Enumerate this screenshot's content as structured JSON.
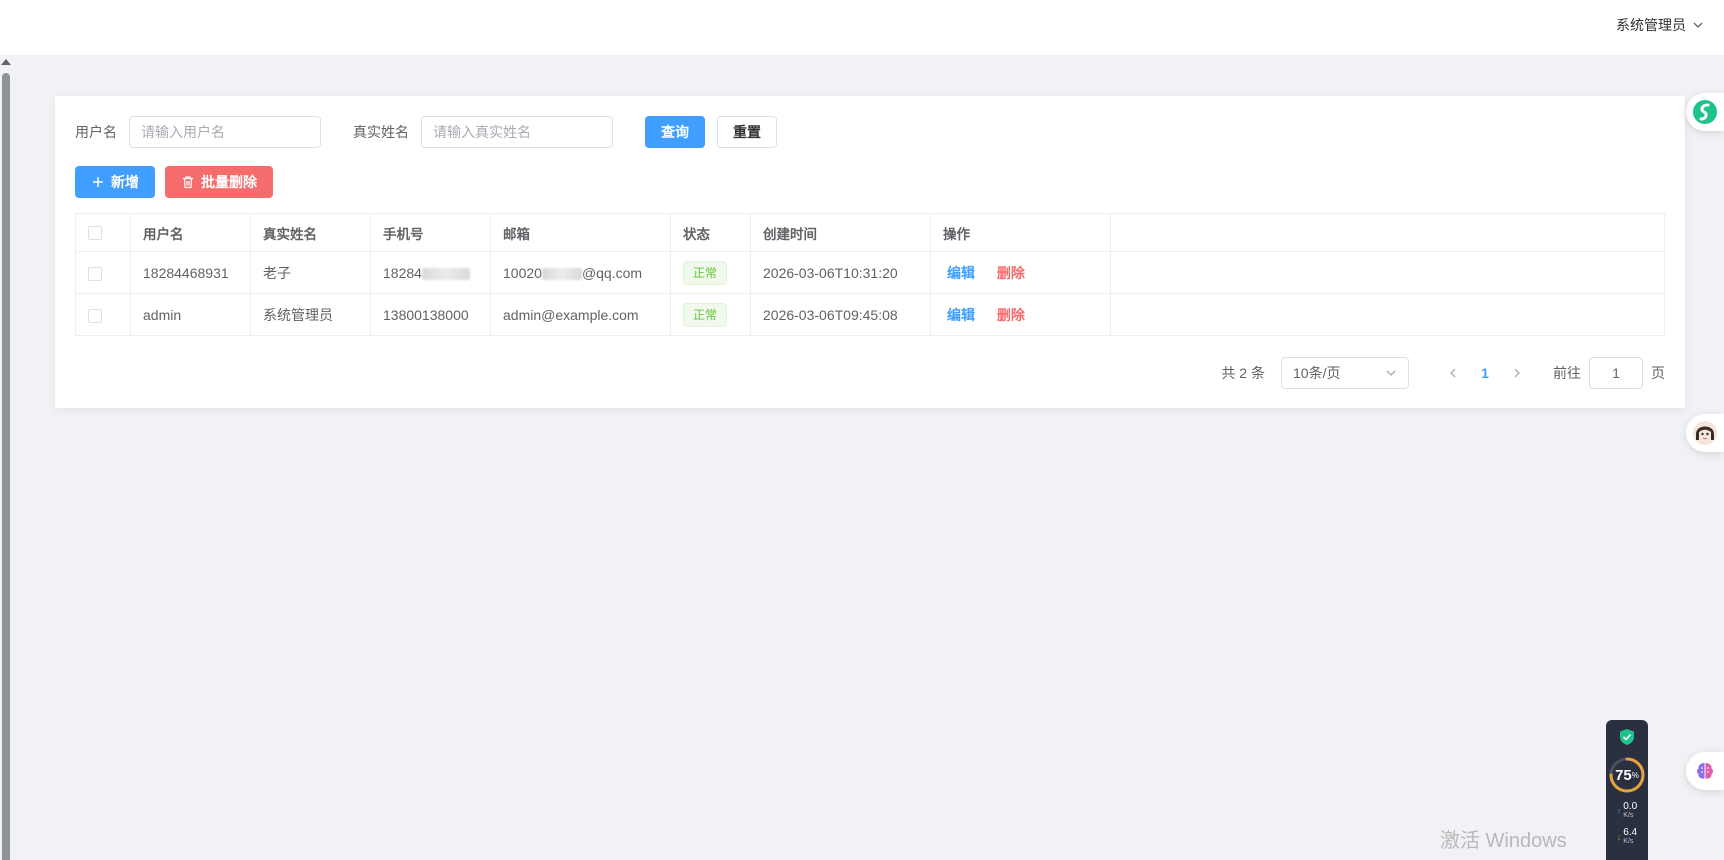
{
  "header": {
    "user_name": "系统管理员"
  },
  "filters": {
    "username_label": "用户名",
    "username_placeholder": "请输入用户名",
    "realname_label": "真实姓名",
    "realname_placeholder": "请输入真实姓名",
    "search_label": "查询",
    "reset_label": "重置"
  },
  "actions": {
    "add_label": "新增",
    "batch_delete_label": "批量删除"
  },
  "table": {
    "columns": [
      "用户名",
      "真实姓名",
      "手机号",
      "邮箱",
      "状态",
      "创建时间",
      "操作"
    ],
    "rows": [
      {
        "username": "18284468931",
        "real_name": "老子",
        "phone": "18284",
        "email_prefix": "10020",
        "email_suffix": "@qq.com",
        "status": "正常",
        "created": "2026-03-06T10:31:20",
        "edit": "编辑",
        "delete": "删除"
      },
      {
        "username": "admin",
        "real_name": "系统管理员",
        "phone": "13800138000",
        "email": "admin@example.com",
        "status": "正常",
        "created": "2026-03-06T09:45:08",
        "edit": "编辑",
        "delete": "删除"
      }
    ]
  },
  "pagination": {
    "total": "共 2 条",
    "page_size": "10条/页",
    "current_page": "1",
    "goto_label": "前往",
    "goto_value": "1",
    "page_suffix": "页"
  },
  "monitor": {
    "cpu_percent": "75",
    "percent_sign": "%",
    "upload": "0.0",
    "download": "6.4",
    "unit": "K/s"
  },
  "watermark": "激活 Windows",
  "colors": {
    "primary": "#409eff",
    "danger": "#f56c6c",
    "success": "#67c23a"
  }
}
